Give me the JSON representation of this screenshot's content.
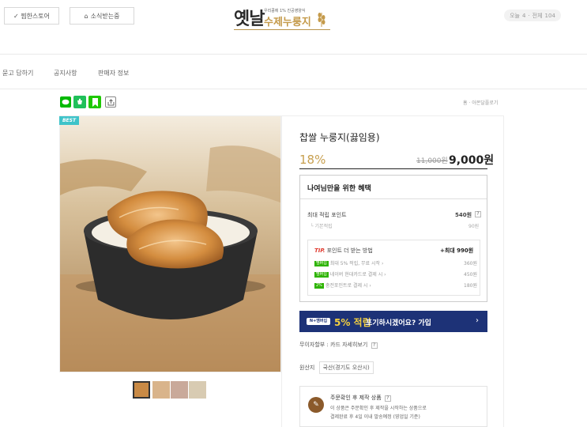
{
  "header": {
    "store_button": "✓ 찜한스토어",
    "news_button": "소식받는중",
    "logo": {
      "main": "옛날",
      "tagline": "우리콩에 1% 진공영양식",
      "brand": "수제누룽지"
    },
    "visitors": {
      "today_label": "오늘",
      "today": "4",
      "total_label": "전체",
      "total": "104"
    }
  },
  "nav": {
    "items": [
      "묻고 답하기",
      "공지사항",
      "판매자 정보"
    ]
  },
  "share": {
    "icons": [
      "line-icon",
      "kakaostory-icon",
      "band-icon",
      "share-icon"
    ],
    "band_label": "BAND"
  },
  "breadcrumb": "홈 · 아몬달플로기",
  "product": {
    "badge": "BEST",
    "title": "찹쌀 누룽지(끓임용)",
    "discount": "18%",
    "original_price": "11,000원",
    "price": "9,000원"
  },
  "benefit": {
    "title": "나여님만을 위한 혜택",
    "max_points_label": "최대 적립 포인트",
    "max_points": "540원",
    "basic_label": "기본적립",
    "basic_value": "90원",
    "tip": {
      "tip_label": "TIP.",
      "text": "포인트 더 받는 방법",
      "max": "+최대 990원",
      "rows": [
        {
          "tag": "멤버십",
          "label": "최대 5% 적립, 무료 시작",
          "value": "360원",
          "tag_color": "#2db400"
        },
        {
          "tag": "멤버십",
          "label": "네이버 현대카드로 결제 시",
          "value": "450원",
          "tag_color": "#2db400"
        },
        {
          "tag": "2%",
          "label": "충전포인트로 결제 시",
          "value": "180원",
          "tag_color": "#2db400"
        }
      ]
    }
  },
  "banner": {
    "tag": "N+멤버십",
    "percent": "5% 적립",
    "message": "포기하시겠어요? 가입",
    "arrow": "›"
  },
  "card_benefit": {
    "label": "무이자할부 : 카드 자세히보기",
    "q": "?"
  },
  "origin": {
    "label": "원산지",
    "value": "국산(경기도 오산시)"
  },
  "made_to_order": {
    "title": "주문확인 후 제작 상품",
    "q": "?",
    "line1": "이 상품은 주문확인 후 제작을 시작하는 상품으로",
    "line2": "결제완료 후 4일 이내 발송예정 (영업일 기준)"
  },
  "colors": {
    "accent": "#c8a050",
    "banner": "#1d3277",
    "best": "#3ec3c9",
    "naver_green": "#2db400"
  }
}
